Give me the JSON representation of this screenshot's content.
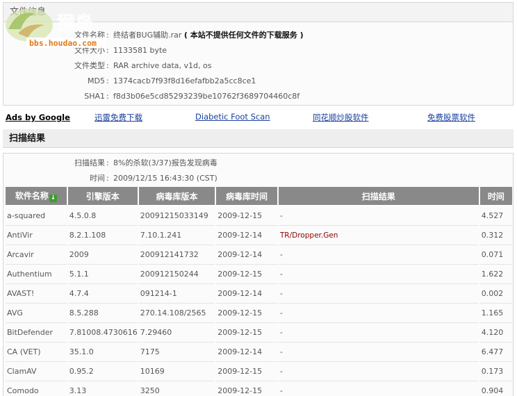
{
  "file_info": {
    "header": "文件信息",
    "rows": [
      {
        "key": "文件名称",
        "value": "终结者BUG辅助.rar",
        "note": "( 本站不提供任何文件的下载服务 )"
      },
      {
        "key": "文件大小",
        "value": "1133581 byte"
      },
      {
        "key": "文件类型",
        "value": "RAR archive data, v1d, os"
      },
      {
        "key": "MD5",
        "value": "1374cacb7f93f8d16efafbb2a5cc8ce1"
      },
      {
        "key": "SHA1",
        "value": "f8d3b06e5cd85293239be10762f3689704460c8f"
      }
    ],
    "separator": ":"
  },
  "logo": {
    "text": "bbs.houdao.com",
    "mark": "猴岛"
  },
  "ads": {
    "label": "Ads by Google",
    "links": [
      "迅雷免费下载",
      "Diabetic Foot Scan",
      "同花顺炒股软件",
      "免费股票软件"
    ]
  },
  "scan": {
    "header": "扫描结果",
    "summary": [
      {
        "key": "扫描结果",
        "value": "8%的杀软(3/37)报告发现病毒"
      },
      {
        "key": "时间",
        "value": "2009/12/15 16:43:30 (CST)"
      }
    ],
    "columns": [
      "软件名称",
      "引擎版本",
      "病毒库版本",
      "病毒库时间",
      "扫描结果",
      "时间"
    ],
    "rows": [
      [
        "a-squared",
        "4.5.0.8",
        "20091215033149",
        "2009-12-15",
        "-",
        "4.527"
      ],
      [
        "AntiVir",
        "8.2.1.108",
        "7.10.1.241",
        "2009-12-14",
        "TR/Dropper.Gen",
        "0.312"
      ],
      [
        "Arcavir",
        "2009",
        "200912141732",
        "2009-12-14",
        "-",
        "0.071"
      ],
      [
        "Authentium",
        "5.1.1",
        "200912150244",
        "2009-12-15",
        "-",
        "1.622"
      ],
      [
        "AVAST!",
        "4.7.4",
        "091214-1",
        "2009-12-14",
        "-",
        "0.002"
      ],
      [
        "AVG",
        "8.5.288",
        "270.14.108/2565",
        "2009-12-15",
        "-",
        "1.165"
      ],
      [
        "BitDefender",
        "7.81008.4730616",
        "7.29460",
        "2009-12-15",
        "-",
        "4.120"
      ],
      [
        "CA (VET)",
        "35.1.0",
        "7175",
        "2009-12-14",
        "-",
        "6.477"
      ],
      [
        "ClamAV",
        "0.95.2",
        "10169",
        "2009-12-15",
        "-",
        "0.173"
      ],
      [
        "Comodo",
        "3.13",
        "3250",
        "2009-12-15",
        "-",
        "0.904"
      ]
    ]
  },
  "colors": {
    "header_bg": "#898989",
    "virus": "#8b0000",
    "link": "#1a3fa0"
  }
}
